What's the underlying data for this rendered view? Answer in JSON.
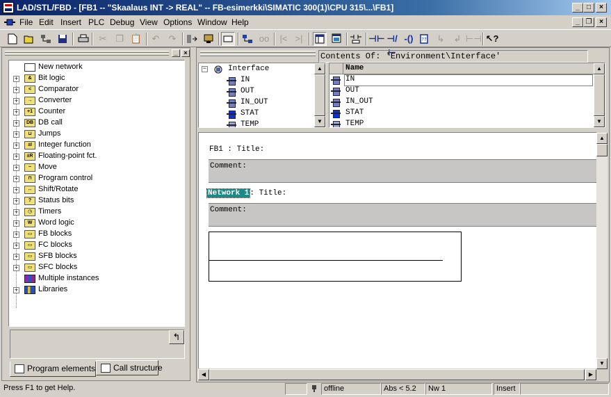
{
  "window": {
    "title": "LAD/STL/FBD - [FB1 -- \"Skaalaus INT -> REAL\" -- FB-esimerkki\\SIMATIC 300(1)\\CPU 315\\...\\FB1]",
    "minimize_glyph": "_",
    "maximize_glyph": "□",
    "close_glyph": "×"
  },
  "menu": {
    "items": [
      "File",
      "Edit",
      "Insert",
      "PLC",
      "Debug",
      "View",
      "Options",
      "Window",
      "Help"
    ],
    "restore_glyph": "❐"
  },
  "toolbar": {
    "icon_names": [
      "new-icon",
      "open-icon",
      "network-icon",
      "save-icon",
      "print-icon",
      "cut-icon",
      "copy-icon",
      "paste-icon",
      "undo-icon",
      "redo-icon",
      "download-icon",
      "monitor-icon",
      "select-icon",
      "accessible-nodes-icon",
      "glasses-icon",
      "first-network-icon",
      "last-network-icon",
      "overview-icon",
      "detail-icon",
      "new-network-icon",
      "contact-no-icon",
      "contact-nc-icon",
      "coil-icon",
      "empty-box-icon",
      "branch-open-icon",
      "branch-close-icon",
      "connection-icon",
      "help-icon"
    ],
    "glyphs": {
      "network_insert": "⊣⊢",
      "coil": "-()",
      "contact_nc": "⊣/⊢",
      "help": "↖?"
    }
  },
  "left_pane": {
    "tree": [
      {
        "label": "New network",
        "icon": "network-icon",
        "expandable": false,
        "icon_text": ""
      },
      {
        "label": "Bit logic",
        "icon": "bit-logic-icon",
        "expandable": true,
        "icon_text": "&"
      },
      {
        "label": "Comparator",
        "icon": "comparator-icon",
        "expandable": true,
        "icon_text": "<"
      },
      {
        "label": "Converter",
        "icon": "converter-icon",
        "expandable": true,
        "icon_text": "→"
      },
      {
        "label": "Counter",
        "icon": "counter-icon",
        "expandable": true,
        "icon_text": "+1"
      },
      {
        "label": "DB call",
        "icon": "db-call-icon",
        "expandable": true,
        "icon_text": "DB"
      },
      {
        "label": "Jumps",
        "icon": "jumps-icon",
        "expandable": true,
        "icon_text": "⊔"
      },
      {
        "label": "Integer function",
        "icon": "integer-function-icon",
        "expandable": true,
        "icon_text": "±I"
      },
      {
        "label": "Floating-point fct.",
        "icon": "floating-point-icon",
        "expandable": true,
        "icon_text": "±R"
      },
      {
        "label": "Move",
        "icon": "move-icon",
        "expandable": true,
        "icon_text": "~"
      },
      {
        "label": "Program control",
        "icon": "program-control-icon",
        "expandable": true,
        "icon_text": "⊓"
      },
      {
        "label": "Shift/Rotate",
        "icon": "shift-rotate-icon",
        "expandable": true,
        "icon_text": "↔"
      },
      {
        "label": "Status bits",
        "icon": "status-bits-icon",
        "expandable": true,
        "icon_text": "?"
      },
      {
        "label": "Timers",
        "icon": "timers-icon",
        "expandable": true,
        "icon_text": "◷"
      },
      {
        "label": "Word logic",
        "icon": "word-logic-icon",
        "expandable": true,
        "icon_text": "W"
      },
      {
        "label": "FB blocks",
        "icon": "fb-blocks-icon",
        "expandable": true,
        "icon_text": "▭"
      },
      {
        "label": "FC blocks",
        "icon": "fc-blocks-icon",
        "expandable": true,
        "icon_text": "▭"
      },
      {
        "label": "SFB blocks",
        "icon": "sfb-blocks-icon",
        "expandable": true,
        "icon_text": "▭"
      },
      {
        "label": "SFC blocks",
        "icon": "sfc-blocks-icon",
        "expandable": true,
        "icon_text": "▭"
      },
      {
        "label": "Multiple instances",
        "icon": "multiple-instances-icon",
        "expandable": false,
        "icon_text": ""
      },
      {
        "label": "Libraries",
        "icon": "libraries-icon",
        "expandable": true,
        "icon_text": ""
      }
    ],
    "pin_glyph": "↰",
    "tabs": [
      {
        "label": "Program elements",
        "active": true
      },
      {
        "label": "Call structure",
        "active": false
      }
    ]
  },
  "interface": {
    "contents_of": "Contents Of: 'Environment\\Interface'",
    "tree_root": "Interface",
    "tree_items": [
      "IN",
      "OUT",
      "IN_OUT",
      "STAT",
      "TEMP"
    ],
    "list_header": "Name",
    "list_items": [
      "IN",
      "OUT",
      "IN_OUT",
      "STAT",
      "TEMP"
    ]
  },
  "editor": {
    "block_title": "FB1 : Title:",
    "comment_label": "Comment:",
    "network_label": "Network 1",
    "network_title": ": Title:",
    "network_comment_label": "Comment:"
  },
  "status": {
    "help": "Press F1 to get Help.",
    "mode": "offline",
    "version": "Abs < 5.2",
    "network": "Nw 1",
    "insert": "Insert"
  }
}
